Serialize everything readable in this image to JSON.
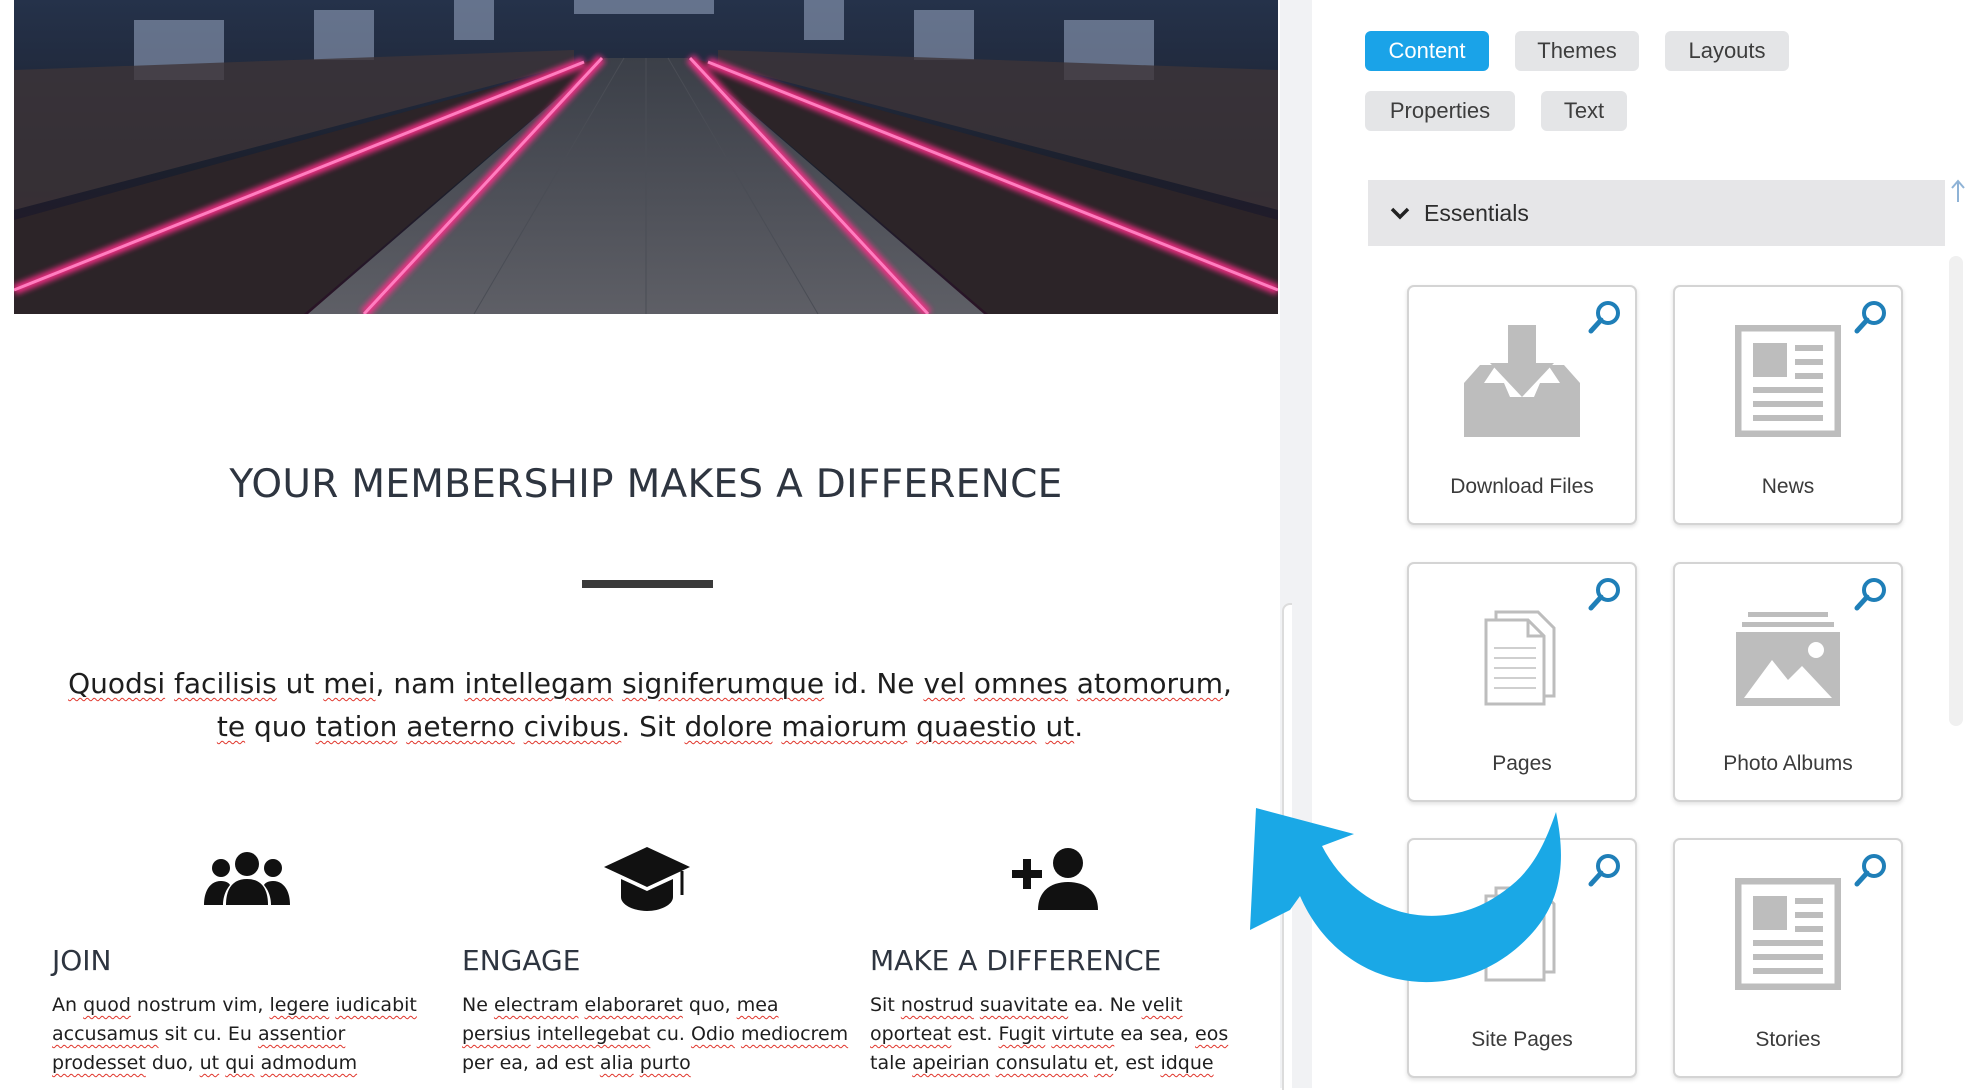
{
  "preview": {
    "headline": "YOUR MEMBERSHIP MAKES A DIFFERENCE",
    "intro": [
      {
        "t": "Quodsi",
        "sq": true
      },
      {
        "t": " "
      },
      {
        "t": "facilisis",
        "sq": true
      },
      {
        "t": " ut "
      },
      {
        "t": "mei",
        "sq": true
      },
      {
        "t": ", nam "
      },
      {
        "t": "intellegam",
        "sq": true
      },
      {
        "t": " "
      },
      {
        "t": "signiferumque",
        "sq": true
      },
      {
        "t": " id. Ne "
      },
      {
        "t": "vel",
        "sq": true
      },
      {
        "t": " "
      },
      {
        "t": "omnes",
        "sq": true
      },
      {
        "t": " "
      },
      {
        "t": "atomorum",
        "sq": true
      },
      {
        "t": ", "
      },
      {
        "t": "te",
        "sq": true
      },
      {
        "t": " quo "
      },
      {
        "t": "tation",
        "sq": true
      },
      {
        "t": " "
      },
      {
        "t": "aeterno",
        "sq": true
      },
      {
        "t": " "
      },
      {
        "t": "civibus",
        "sq": true
      },
      {
        "t": ". Sit "
      },
      {
        "t": "dolore",
        "sq": true
      },
      {
        "t": " "
      },
      {
        "t": "maiorum",
        "sq": true
      },
      {
        "t": " "
      },
      {
        "t": "quaestio",
        "sq": true
      },
      {
        "t": " "
      },
      {
        "t": "ut",
        "sq": true
      },
      {
        "t": ". "
      }
    ],
    "columns": [
      {
        "icon": "group-icon",
        "title": "JOIN",
        "text": [
          {
            "t": "An "
          },
          {
            "t": "quod",
            "sq": true
          },
          {
            "t": " nostrum vim, "
          },
          {
            "t": "legere",
            "sq": true
          },
          {
            "t": " "
          },
          {
            "t": "iudicabit",
            "sq": true
          },
          {
            "t": " "
          },
          {
            "t": "accusamus",
            "sq": true
          },
          {
            "t": " sit cu. Eu "
          },
          {
            "t": "assentior",
            "sq": true
          },
          {
            "t": " "
          },
          {
            "t": "prodesset",
            "sq": true
          },
          {
            "t": " duo, "
          },
          {
            "t": "ut",
            "sq": true
          },
          {
            "t": " "
          },
          {
            "t": "qui",
            "sq": true
          },
          {
            "t": " "
          },
          {
            "t": "admodum",
            "sq": true
          }
        ]
      },
      {
        "icon": "graduation-cap-icon",
        "title": "ENGAGE",
        "text": [
          {
            "t": "Ne "
          },
          {
            "t": "electram",
            "sq": true
          },
          {
            "t": " "
          },
          {
            "t": "elaboraret",
            "sq": true
          },
          {
            "t": " quo, "
          },
          {
            "t": "mea",
            "sq": true
          },
          {
            "t": " "
          },
          {
            "t": "persius",
            "sq": true
          },
          {
            "t": " "
          },
          {
            "t": "intellegebat",
            "sq": true
          },
          {
            "t": " cu. "
          },
          {
            "t": "Odio",
            "sq": true
          },
          {
            "t": " "
          },
          {
            "t": "mediocrem",
            "sq": true
          },
          {
            "t": " per ea, ad est "
          },
          {
            "t": "alia",
            "sq": true
          },
          {
            "t": " "
          },
          {
            "t": "purto",
            "sq": true
          }
        ]
      },
      {
        "icon": "add-person-icon",
        "title": "MAKE A DIFFERENCE",
        "text": [
          {
            "t": "Sit "
          },
          {
            "t": "nostrud",
            "sq": true
          },
          {
            "t": " "
          },
          {
            "t": "suavitate",
            "sq": true
          },
          {
            "t": " ea. Ne "
          },
          {
            "t": "velit",
            "sq": true
          },
          {
            "t": " "
          },
          {
            "t": "oporteat",
            "sq": true
          },
          {
            "t": " est. "
          },
          {
            "t": "Fugit",
            "sq": true
          },
          {
            "t": " "
          },
          {
            "t": "virtute",
            "sq": true
          },
          {
            "t": " ea sea, "
          },
          {
            "t": "eos",
            "sq": true
          },
          {
            "t": " tale "
          },
          {
            "t": "apeirian",
            "sq": true
          },
          {
            "t": " "
          },
          {
            "t": "consulatu",
            "sq": true
          },
          {
            "t": " "
          },
          {
            "t": "et",
            "sq": true
          },
          {
            "t": ", est "
          },
          {
            "t": "idque",
            "sq": true
          }
        ]
      }
    ]
  },
  "panel": {
    "tabs": [
      {
        "label": "Content",
        "active": true
      },
      {
        "label": "Themes",
        "active": false
      },
      {
        "label": "Layouts",
        "active": false
      },
      {
        "label": "Properties",
        "active": false
      },
      {
        "label": "Text",
        "active": false
      }
    ],
    "section": {
      "label": "Essentials",
      "expanded": true
    },
    "cards": [
      {
        "label": "Download Files",
        "icon": "download-tray-icon"
      },
      {
        "label": "News",
        "icon": "newspaper-icon"
      },
      {
        "label": "Pages",
        "icon": "pages-icon"
      },
      {
        "label": "Photo Albums",
        "icon": "photo-icon"
      },
      {
        "label": "Site Pages",
        "icon": "pages-icon"
      },
      {
        "label": "Stories",
        "icon": "newspaper-icon"
      }
    ]
  },
  "colors": {
    "accent": "#1aa3e8",
    "tab_inactive": "#e4e5e7",
    "card_icon": "#bdbdbd",
    "zoom_icon": "#1f7fb8",
    "arrow": "#1aa8e6"
  }
}
